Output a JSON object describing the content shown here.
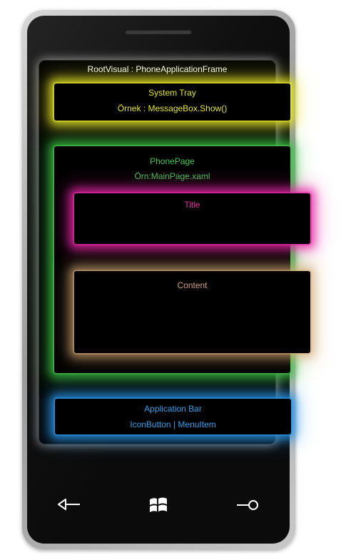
{
  "root_label": "RootVisual : PhoneApplicationFrame",
  "system_tray": {
    "title": "System Tray",
    "example": "Örnek : MessageBox.Show()"
  },
  "phone_page": {
    "title": "PhonePage",
    "example": "Örn:MainPage.xaml"
  },
  "title_region": {
    "label": "Title"
  },
  "content_region": {
    "label": "Content"
  },
  "application_bar": {
    "title": "Application Bar",
    "items": "IconButton | MenuItem"
  },
  "hardware_buttons": [
    "back-icon",
    "windows-logo-icon",
    "search-icon"
  ],
  "colors": {
    "system_tray": "#e6e61c",
    "phone_page": "#3cc84a",
    "title": "#ee2aa8",
    "content": "#d4a070",
    "application_bar": "#2aa0ee",
    "root": "#ffffff"
  }
}
